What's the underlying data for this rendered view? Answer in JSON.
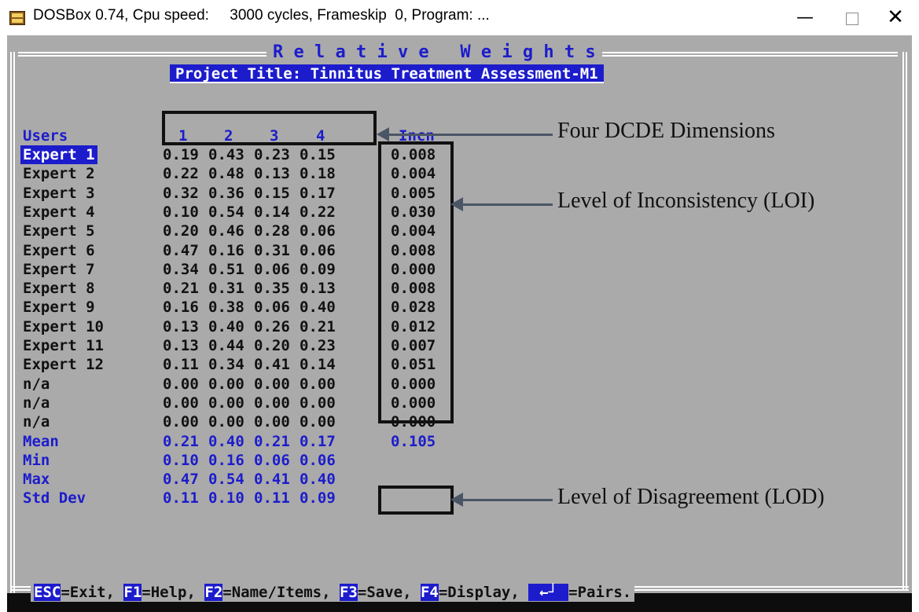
{
  "window": {
    "title": "DOSBox 0.74, Cpu speed:     3000 cycles, Frameskip  0, Program: ...",
    "minimize": "—",
    "close": "✕",
    "app_icon": "dosbox-icon"
  },
  "screen": {
    "heading": "R e l a t i v e   W e i g h t s",
    "project_title": "Project Title: Tinnitus Treatment Assessment-M1",
    "col_users": "Users",
    "columns": [
      "1",
      "2",
      "3",
      "4",
      "Incn"
    ],
    "rows": [
      {
        "label": "Expert 1",
        "values": [
          "0.19",
          "0.43",
          "0.23",
          "0.15",
          "0.008"
        ]
      },
      {
        "label": "Expert 2",
        "values": [
          "0.22",
          "0.48",
          "0.13",
          "0.18",
          "0.004"
        ]
      },
      {
        "label": "Expert 3",
        "values": [
          "0.32",
          "0.36",
          "0.15",
          "0.17",
          "0.005"
        ]
      },
      {
        "label": "Expert 4",
        "values": [
          "0.10",
          "0.54",
          "0.14",
          "0.22",
          "0.030"
        ]
      },
      {
        "label": "Expert 5",
        "values": [
          "0.20",
          "0.46",
          "0.28",
          "0.06",
          "0.004"
        ]
      },
      {
        "label": "Expert 6",
        "values": [
          "0.47",
          "0.16",
          "0.31",
          "0.06",
          "0.008"
        ]
      },
      {
        "label": "Expert 7",
        "values": [
          "0.34",
          "0.51",
          "0.06",
          "0.09",
          "0.000"
        ]
      },
      {
        "label": "Expert 8",
        "values": [
          "0.21",
          "0.31",
          "0.35",
          "0.13",
          "0.008"
        ]
      },
      {
        "label": "Expert 9",
        "values": [
          "0.16",
          "0.38",
          "0.06",
          "0.40",
          "0.028"
        ]
      },
      {
        "label": "Expert 10",
        "values": [
          "0.13",
          "0.40",
          "0.26",
          "0.21",
          "0.012"
        ]
      },
      {
        "label": "Expert 11",
        "values": [
          "0.13",
          "0.44",
          "0.20",
          "0.23",
          "0.007"
        ]
      },
      {
        "label": "Expert 12",
        "values": [
          "0.11",
          "0.34",
          "0.41",
          "0.14",
          "0.051"
        ]
      },
      {
        "label": "n/a",
        "values": [
          "0.00",
          "0.00",
          "0.00",
          "0.00",
          "0.000"
        ]
      },
      {
        "label": "n/a",
        "values": [
          "0.00",
          "0.00",
          "0.00",
          "0.00",
          "0.000"
        ]
      },
      {
        "label": "n/a",
        "values": [
          "0.00",
          "0.00",
          "0.00",
          "0.00",
          "0.000"
        ]
      }
    ],
    "stats": [
      {
        "label": "Mean",
        "values": [
          "0.21",
          "0.40",
          "0.21",
          "0.17",
          "0.105"
        ]
      },
      {
        "label": "Min",
        "values": [
          "0.10",
          "0.16",
          "0.06",
          "0.06",
          ""
        ]
      },
      {
        "label": "Max",
        "values": [
          "0.47",
          "0.54",
          "0.41",
          "0.40",
          ""
        ]
      },
      {
        "label": "Std Dev",
        "values": [
          "0.11",
          "0.10",
          "0.11",
          "0.09",
          ""
        ]
      }
    ],
    "footer": {
      "esc": "ESC",
      "esc_text": "=Exit, ",
      "f1": "F1",
      "f1_text": "=Help, ",
      "f2": "F2",
      "f2_text": "=Name/Items, ",
      "f3": "F3",
      "f3_text": "=Save, ",
      "f4": "F4",
      "f4_text": "=Display, ",
      "enter": "←┘",
      "enter_text": "=Pairs."
    }
  },
  "annotations": {
    "dimensions": "Four DCDE Dimensions",
    "loi": "Level of Inconsistency (LOI)",
    "lod": "Level of Disagreement (LOD)"
  },
  "colors": {
    "dos_background": "#aaaaaa",
    "dos_blue": "#1c1ccc",
    "dos_white": "#ffffff",
    "annotation_arrow": "#4a5565"
  }
}
